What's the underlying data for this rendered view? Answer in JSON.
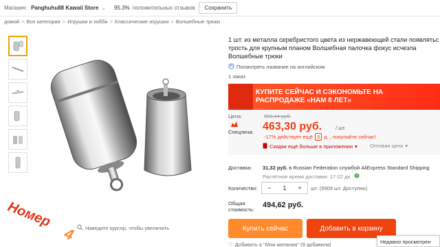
{
  "topbar": {
    "store_label": "Магазин:",
    "store_name": "Panghuhu88 Kawaii Store",
    "rating_pct": "95.3%",
    "rating_text": "положительных отзывов",
    "save_label": "Сохранить"
  },
  "breadcrumbs": [
    "домой",
    "Все категории",
    "Игрушки и хобби",
    "Классические игрушки",
    "Волшебные трюки"
  ],
  "image": {
    "zoom_hint": "Наведите курсор, чтобы увеличить",
    "stamp_text_1": "Номер",
    "stamp_text_2": "4"
  },
  "product": {
    "title_1": "1 шт. из металла серебристого цвета из нержавеющей стали появлятьс",
    "title_2": "трость для крупным планом Волшебная палочка фокус исчезла",
    "title_3": "Волшебные трюки",
    "translate_link": "Посмотреть название на английском",
    "orders": "1 заказ"
  },
  "promo": {
    "line1": "КУПИТЕ СЕЙЧАС И СЭКОНОМЬТЕ НА",
    "line2": "РАСПРОДАЖЕ «НАМ 8 ЛЕТ»"
  },
  "price": {
    "price_label": "Цена:",
    "old_price": "558,44 руб.",
    "unit": "/ шт.",
    "sale_label": "Спецпена:",
    "new_price": "463,30 руб.",
    "discount": "-17% действует ещё",
    "days_box": "3",
    "days_rest": "д. , покупайте сейчас!",
    "app_discount": "Скидки ещё больше в приложении",
    "wholesale": "Оптовая цена"
  },
  "shipping": {
    "label": "Доставка:",
    "cost": "31,32 руб.",
    "method": "в Russian Federation службой AliExpress Standard Shipping",
    "estimate": "Расчётное время доставки: 17-22 дн."
  },
  "quantity": {
    "label": "Количество:",
    "minus": "−",
    "value": "1",
    "plus": "+",
    "available": "шт. (9909 шт. Доступно)"
  },
  "total": {
    "label": "Общая стоимость:",
    "value": "494,62 руб."
  },
  "actions": {
    "buy_now": "Купить сейчас",
    "add_to_cart": "Добавить в корзину",
    "wishlist": "Добавить в \"Мои желания\" (9 добавили)"
  },
  "recent_panel": "Недавно просмотрен",
  "colors": {
    "accent_orange": "#ff8a2b",
    "accent_red": "#f0440f",
    "price_red": "#f03c14"
  }
}
